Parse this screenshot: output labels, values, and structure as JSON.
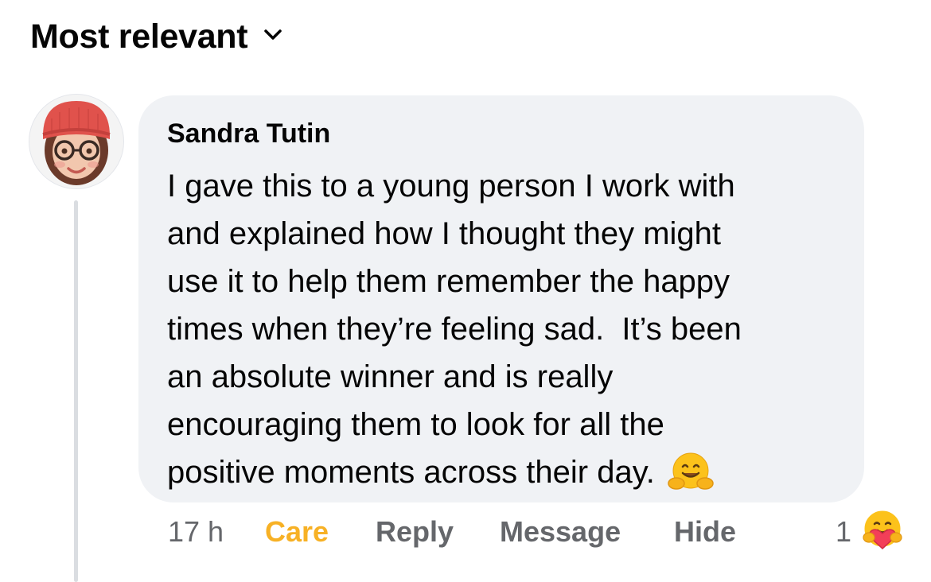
{
  "sort": {
    "label": "Most relevant",
    "icon": "chevron-down-icon"
  },
  "comment": {
    "author": "Sandra Tutin",
    "body_lines": [
      "I gave this to a young person I work with",
      "and explained how I thought they might",
      "use it to help them remember the happy",
      "times when they’re feeling sad.  It’s been",
      "an absolute winner and is really",
      "encouraging them to look for all the",
      "positive moments across their day."
    ],
    "trailing_emoji": "hugging-face-icon",
    "time": "17 h",
    "actions": {
      "care": "Care",
      "reply": "Reply",
      "message": "Message",
      "hide": "Hide"
    },
    "reaction_count": "1",
    "reaction_icon": "care-heart-icon"
  },
  "colors": {
    "bubble": "#f0f2f5",
    "care": "#f7b125",
    "secondary_text": "#65676b",
    "thread_line": "#dadde1"
  }
}
